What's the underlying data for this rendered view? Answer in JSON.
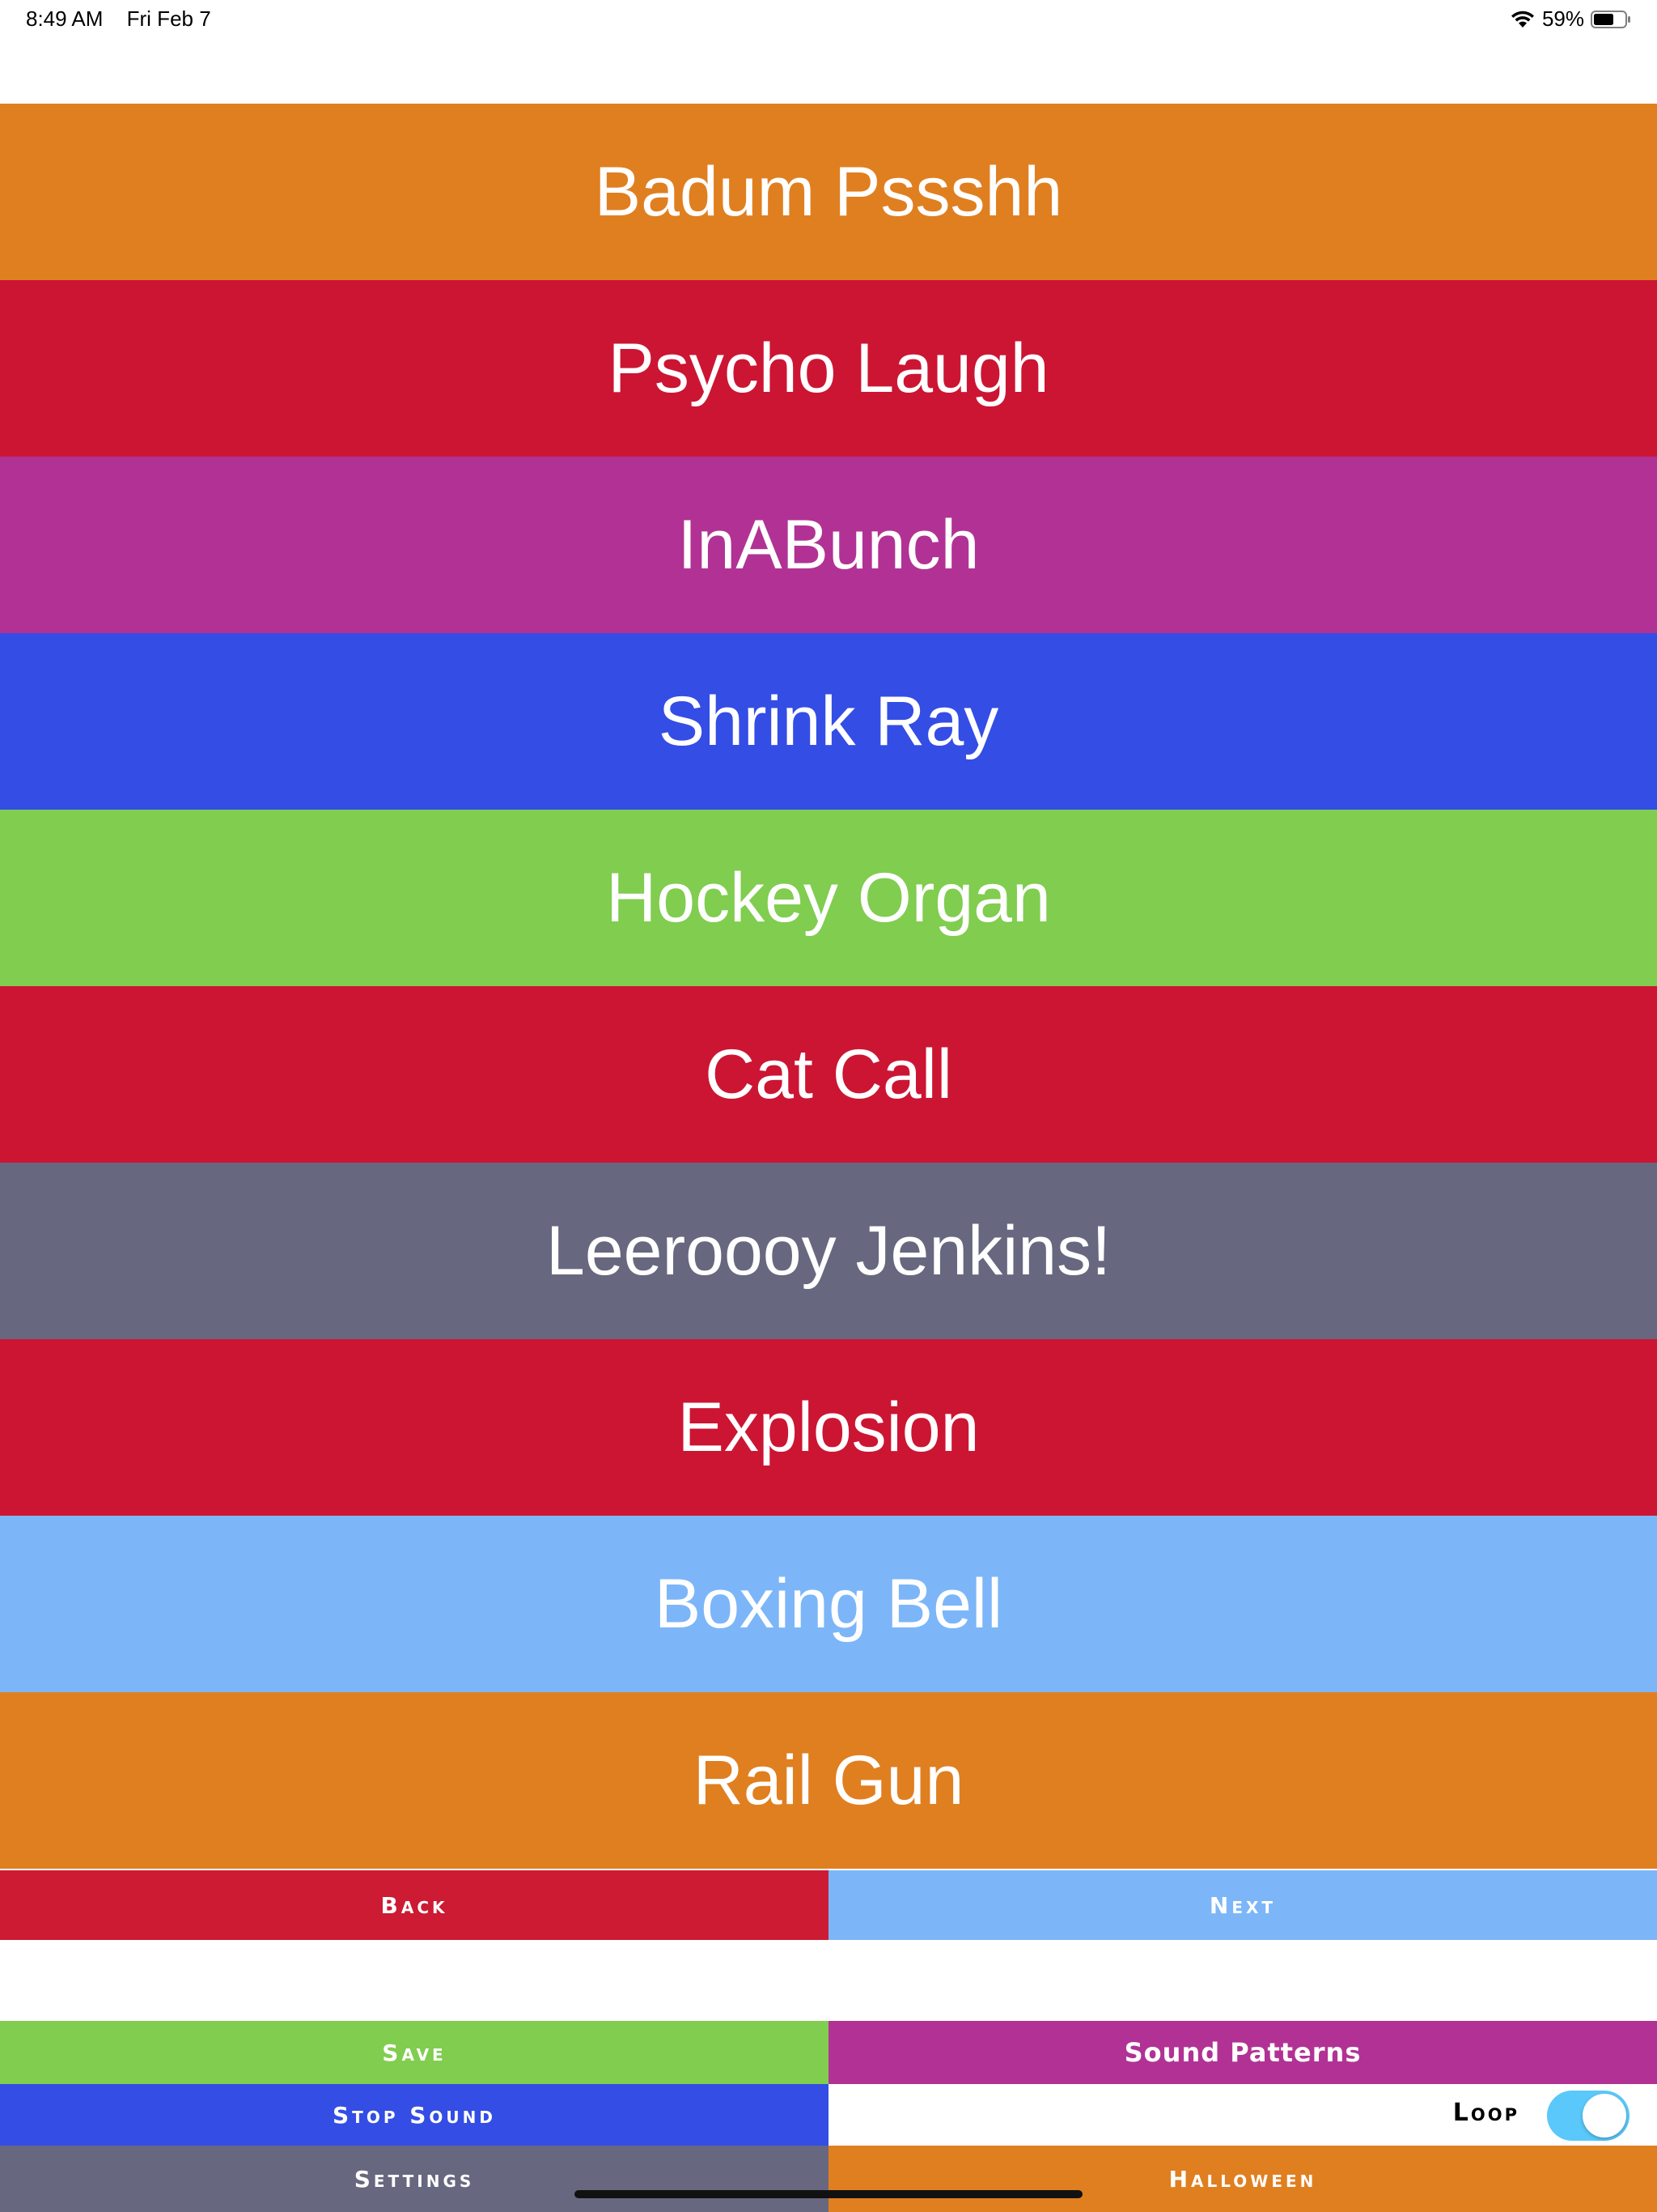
{
  "status_bar": {
    "time": "8:49 AM",
    "date": "Fri Feb 7",
    "battery_percent": "59%",
    "icons": [
      "wifi-icon",
      "battery-icon"
    ]
  },
  "sounds": [
    {
      "label": "Badum Pssshh",
      "color": "#e07f20"
    },
    {
      "label": "Psycho Laugh",
      "color": "#cc1533"
    },
    {
      "label": "InABunch",
      "color": "#b13294"
    },
    {
      "label": "Shrink Ray",
      "color": "#344de5"
    },
    {
      "label": "Hockey Organ",
      "color": "#80cd4f"
    },
    {
      "label": "Cat Call",
      "color": "#cc1533"
    },
    {
      "label": "Leeroooy Jenkins!",
      "color": "#67677f"
    },
    {
      "label": "Explosion",
      "color": "#cc1533"
    },
    {
      "label": "Boxing Bell",
      "color": "#7cb6f8"
    },
    {
      "label": "Rail Gun",
      "color": "#e07f20"
    }
  ],
  "nav": {
    "back_label": "Back",
    "next_label": "Next",
    "back_color": "#cc1b33",
    "next_color": "#7cb6f8"
  },
  "controls": {
    "save_label": "Save",
    "sound_patterns_label": "Sound Patterns",
    "stop_sound_label": "Stop Sound",
    "loop_label": "Loop",
    "loop_enabled": true,
    "settings_label": "Settings",
    "halloween_label": "Halloween",
    "colors": {
      "save": "#80cd4f",
      "sound_patterns": "#b13294",
      "stop_sound": "#344de5",
      "settings": "#67677f",
      "halloween": "#e07f20",
      "toggle_on": "#5ac8fa"
    }
  }
}
